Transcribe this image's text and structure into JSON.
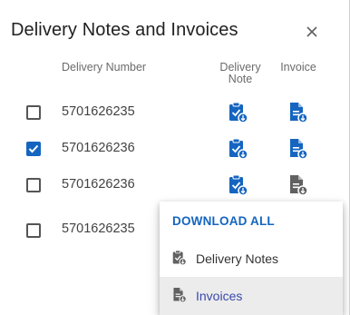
{
  "dialog": {
    "title": "Delivery Notes and Invoices",
    "close_icon": "close-icon"
  },
  "table": {
    "headers": {
      "delivery_number": "Delivery Number",
      "delivery_note_line1": "Delivery",
      "delivery_note_line2": "Note",
      "invoice": "Invoice"
    },
    "rows": [
      {
        "delivery_number": "5701626235",
        "checked": false,
        "note_icon": "clipboard-download-icon",
        "invoice_icon": "document-download-icon"
      },
      {
        "delivery_number": "5701626236",
        "checked": true,
        "note_icon": "clipboard-download-icon",
        "invoice_icon": "document-download-icon"
      },
      {
        "delivery_number": "5701626236",
        "checked": false,
        "note_icon": "clipboard-download-icon",
        "invoice_icon": "document-download-icon"
      },
      {
        "delivery_number": "5701626235",
        "checked": false,
        "note_icon": "clipboard-download-icon",
        "invoice_icon": "document-download-icon"
      }
    ]
  },
  "download_menu": {
    "heading": "DOWNLOAD ALL",
    "items": [
      {
        "label": "Delivery Notes",
        "icon": "clipboard-download-icon",
        "active": false
      },
      {
        "label": "Invoices",
        "icon": "document-download-icon",
        "active": true
      }
    ]
  },
  "colors": {
    "accent_blue": "#1565c0",
    "active_text": "#3949ab",
    "hover_bg": "#ececec",
    "disabled_icon": "#616161"
  }
}
